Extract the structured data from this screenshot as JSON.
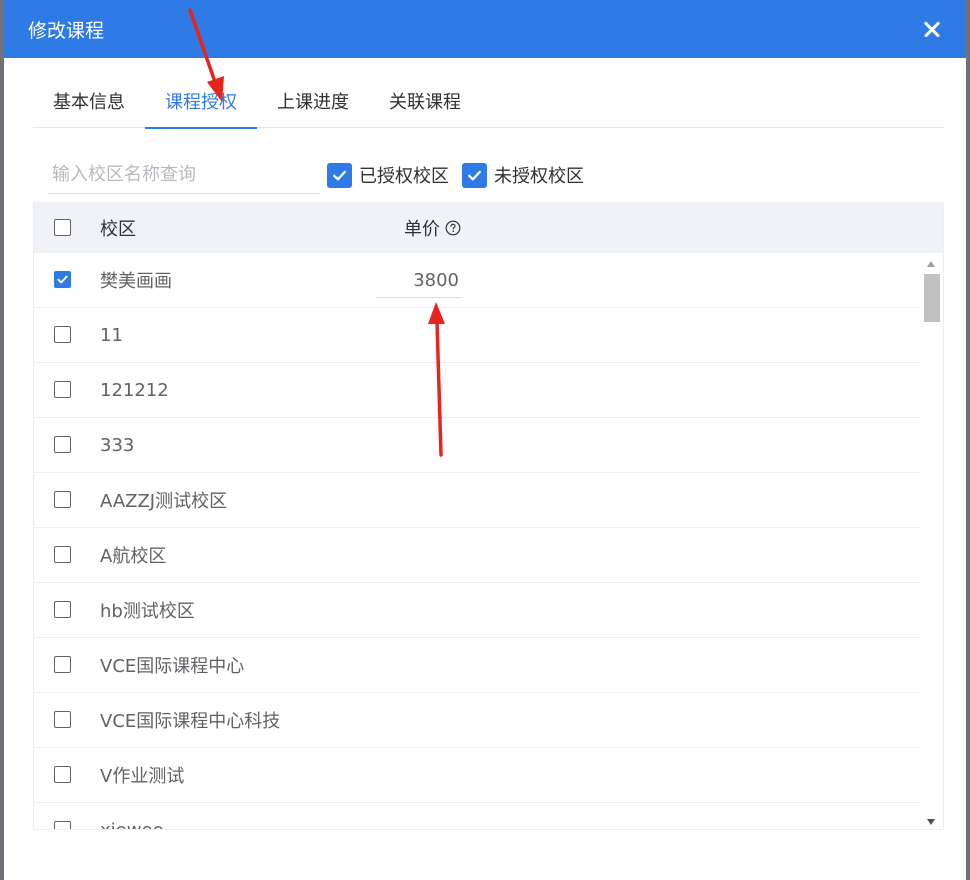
{
  "dialog": {
    "title": "修改课程"
  },
  "tabs": [
    {
      "label": "基本信息",
      "active": false
    },
    {
      "label": "课程授权",
      "active": true
    },
    {
      "label": "上课进度",
      "active": false
    },
    {
      "label": "关联课程",
      "active": false
    }
  ],
  "filters": {
    "search_placeholder": "输入校区名称查询",
    "authorized_label": "已授权校区",
    "authorized_checked": true,
    "unauthorized_label": "未授权校区",
    "unauthorized_checked": true
  },
  "table": {
    "header_checked": false,
    "col_campus": "校区",
    "col_price": "单价",
    "rows": [
      {
        "name": "樊美画画",
        "checked": true,
        "price": "3800"
      },
      {
        "name": "11",
        "checked": false,
        "price": ""
      },
      {
        "name": "121212",
        "checked": false,
        "price": ""
      },
      {
        "name": "333",
        "checked": false,
        "price": ""
      },
      {
        "name": "AAZZJ测试校区",
        "checked": false,
        "price": ""
      },
      {
        "name": "A航校区",
        "checked": false,
        "price": ""
      },
      {
        "name": "hb测试校区",
        "checked": false,
        "price": ""
      },
      {
        "name": "VCE国际课程中心",
        "checked": false,
        "price": ""
      },
      {
        "name": "VCE国际课程中心科技",
        "checked": false,
        "price": ""
      },
      {
        "name": "V作业测试",
        "checked": false,
        "price": ""
      },
      {
        "name": "xiewee",
        "checked": false,
        "price": ""
      }
    ]
  },
  "colors": {
    "primary": "#2e7be5",
    "annotation": "#e8231c"
  }
}
